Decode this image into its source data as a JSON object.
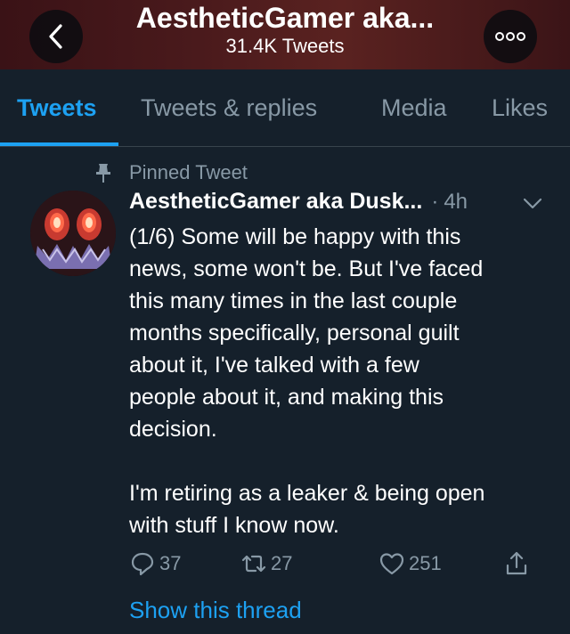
{
  "header": {
    "title": "AestheticGamer aka...",
    "subtitle": "31.4K Tweets",
    "back_icon": "chevron-left-icon",
    "more_icon": "more-icon"
  },
  "tabs": [
    {
      "label": "Tweets",
      "active": true
    },
    {
      "label": "Tweets & replies",
      "active": false
    },
    {
      "label": "Media",
      "active": false
    },
    {
      "label": "Likes",
      "active": false
    }
  ],
  "tweet": {
    "pinned_label": "Pinned Tweet",
    "author_name": "AestheticGamer aka Dusk...",
    "separator": "·",
    "time": "4h",
    "paragraphs": [
      "(1/6) Some will be happy with this\nnews, some won't be. But I've faced\nthis many times in the last couple\nmonths specifically, personal guilt\nabout it, I've talked with a few\npeople about it, and making this\ndecision.",
      "I'm retiring as a leaker & being open\nwith stuff I know now."
    ],
    "replies": "37",
    "retweets": "27",
    "likes": "251",
    "show_thread": "Show this thread"
  },
  "colors": {
    "background": "#15202b",
    "accent": "#1da1f2",
    "muted": "#8899a6",
    "header": "#4a1a1c"
  }
}
